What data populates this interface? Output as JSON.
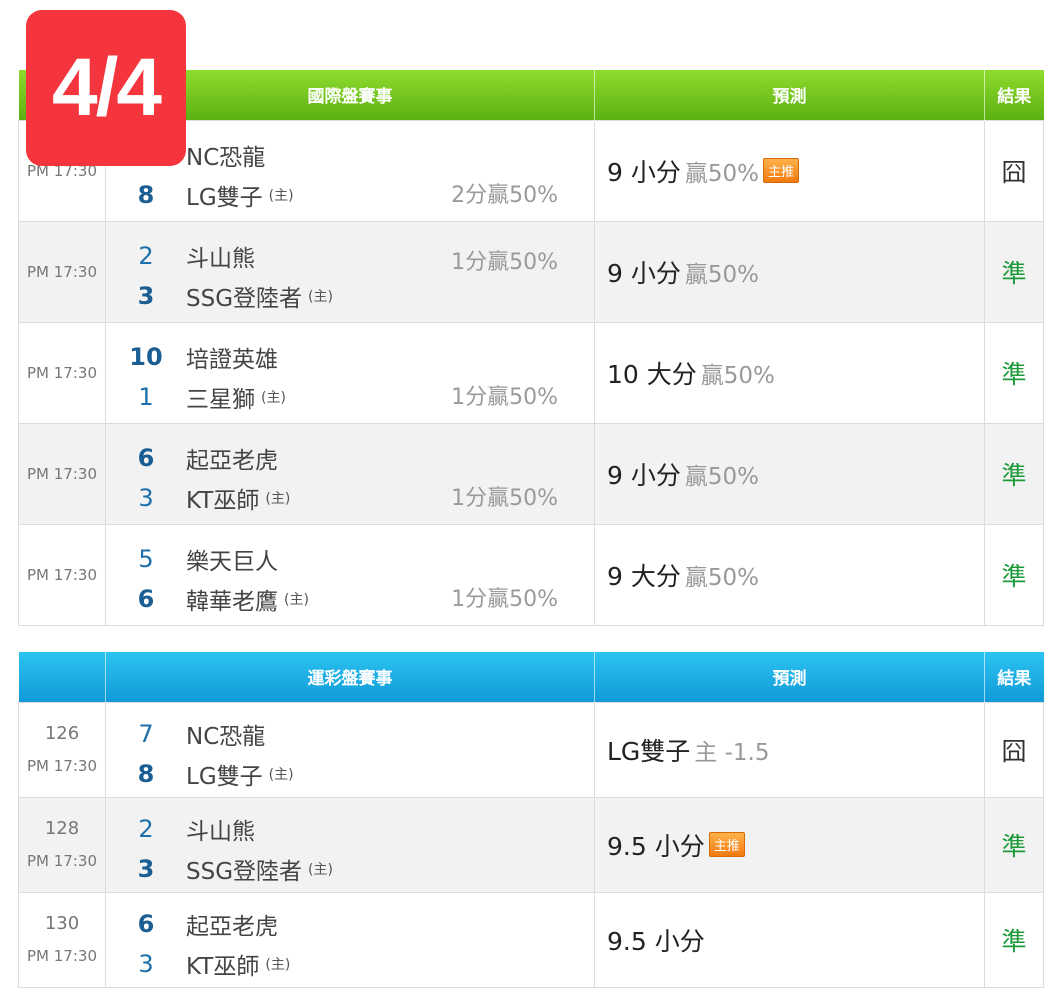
{
  "badge": "4/4",
  "intl": {
    "headers": {
      "match": "國際盤賽事",
      "prediction": "預測",
      "result": "結果"
    },
    "rows": [
      {
        "time": "PM 17:30",
        "away_score": "",
        "away_team": "NC恐龍",
        "home_score": "8",
        "home_team": "LG雙子",
        "home_mark": "(主)",
        "handicap": "2分贏50%",
        "pred_main": "9 小分",
        "pred_note": "贏50%",
        "pick_tag": "主推",
        "result": "囧"
      },
      {
        "time": "PM 17:30",
        "away_score": "2",
        "away_team": "斗山熊",
        "home_score": "3",
        "home_team": "SSG登陸者",
        "home_mark": "(主)",
        "handicap": "1分贏50%",
        "pred_main": "9 小分",
        "pred_note": "贏50%",
        "pick_tag": "",
        "result": "準"
      },
      {
        "time": "PM 17:30",
        "away_score": "10",
        "away_team": "培證英雄",
        "home_score": "1",
        "home_team": "三星獅",
        "home_mark": "(主)",
        "handicap": "1分贏50%",
        "pred_main": "10 大分",
        "pred_note": "贏50%",
        "pick_tag": "",
        "result": "準"
      },
      {
        "time": "PM 17:30",
        "away_score": "6",
        "away_team": "起亞老虎",
        "home_score": "3",
        "home_team": "KT巫師",
        "home_mark": "(主)",
        "handicap": "1分贏50%",
        "pred_main": "9 小分",
        "pred_note": "贏50%",
        "pick_tag": "",
        "result": "準"
      },
      {
        "time": "PM 17:30",
        "away_score": "5",
        "away_team": "樂天巨人",
        "home_score": "6",
        "home_team": "韓華老鷹",
        "home_mark": "(主)",
        "handicap": "1分贏50%",
        "pred_main": "9 大分",
        "pred_note": "贏50%",
        "pick_tag": "",
        "result": "準"
      }
    ]
  },
  "sport": {
    "headers": {
      "match": "運彩盤賽事",
      "prediction": "預測",
      "result": "結果"
    },
    "rows": [
      {
        "game_no": "126",
        "time": "PM 17:30",
        "away_score": "7",
        "away_team": "NC恐龍",
        "home_score": "8",
        "home_team": "LG雙子",
        "home_mark": "(主)",
        "pred_main": "LG雙子",
        "pred_note": "主 -1.5",
        "pick_tag": "",
        "result": "囧"
      },
      {
        "game_no": "128",
        "time": "PM 17:30",
        "away_score": "2",
        "away_team": "斗山熊",
        "home_score": "3",
        "home_team": "SSG登陸者",
        "home_mark": "(主)",
        "pred_main": "9.5 小分",
        "pred_note": "",
        "pick_tag": "主推",
        "result": "準"
      },
      {
        "game_no": "130",
        "time": "PM 17:30",
        "away_score": "6",
        "away_team": "起亞老虎",
        "home_score": "3",
        "home_team": "KT巫師",
        "home_mark": "(主)",
        "pred_main": "9.5 小分",
        "pred_note": "",
        "pick_tag": "",
        "result": "準"
      }
    ]
  }
}
